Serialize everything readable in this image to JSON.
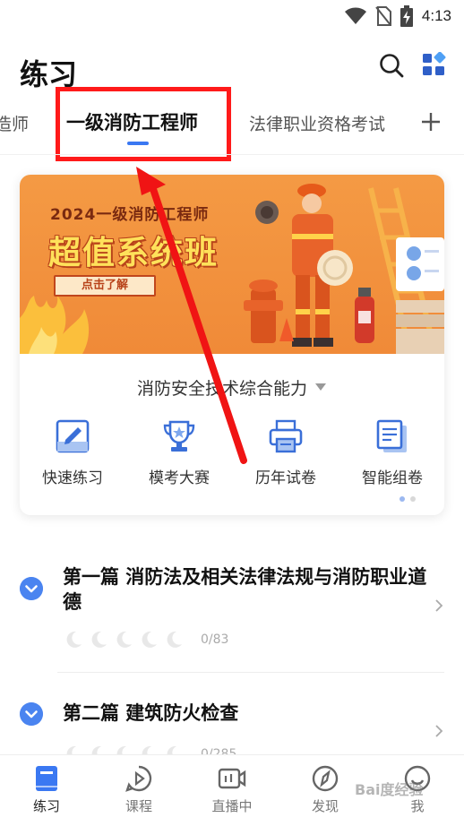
{
  "status_bar": {
    "time": "4:13",
    "icons": [
      "wifi-icon",
      "no-sim-icon",
      "battery-charging-icon"
    ]
  },
  "header": {
    "title": "练习",
    "search_icon": "search-icon",
    "apps_icon": "apps-grid-icon"
  },
  "tabs": {
    "items": [
      {
        "label": "造师"
      },
      {
        "label": "一级消防工程师",
        "active": true
      },
      {
        "label": "法律职业资格考试"
      }
    ],
    "add_icon": "plus-icon"
  },
  "banner": {
    "subtitle": "2024一级消防工程师",
    "title": "超值系统班",
    "button": "点击了解"
  },
  "subject": {
    "selected": "消防安全技术综合能力"
  },
  "tools": [
    {
      "label": "快速练习",
      "icon": "quick-practice-icon"
    },
    {
      "label": "模考大赛",
      "icon": "trophy-icon"
    },
    {
      "label": "历年试卷",
      "icon": "printer-icon"
    },
    {
      "label": "智能组卷",
      "icon": "paper-stack-icon"
    }
  ],
  "chapters": [
    {
      "title": "第一篇 消防法及相关法律法规与消防职业道德",
      "progress": "0/83",
      "stars_filled": 0,
      "stars_total": 5
    },
    {
      "title": "第二篇 建筑防火检查",
      "progress": "0/285",
      "stars_filled": 0,
      "stars_total": 5
    }
  ],
  "bottom_nav": [
    {
      "label": "练习",
      "icon": "book-icon",
      "active": true
    },
    {
      "label": "课程",
      "icon": "play-icon"
    },
    {
      "label": "直播中",
      "icon": "live-video-icon"
    },
    {
      "label": "发现",
      "icon": "compass-icon"
    },
    {
      "label": "我",
      "icon": "smile-icon"
    }
  ],
  "watermark": "Bai度经验",
  "colors": {
    "accent": "#3a78f2",
    "highlight": "#ff1a1a",
    "banner": "#f08a38",
    "chapter_toggle": "#4a84f0"
  }
}
